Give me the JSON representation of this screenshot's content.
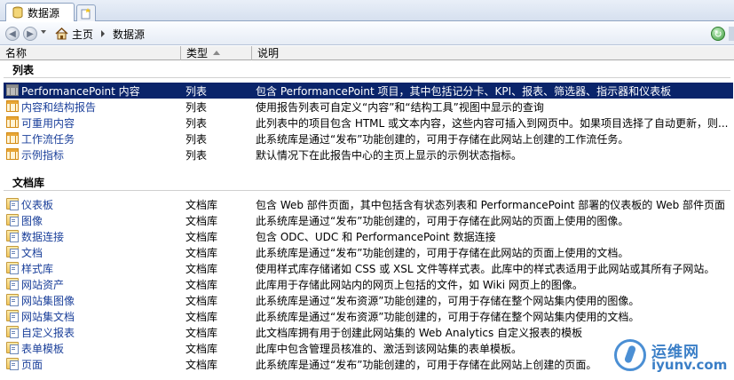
{
  "tabs": [
    {
      "label": "数据源",
      "icon": "database-icon"
    }
  ],
  "new_tab_icon": "new-tab-icon",
  "nav": {
    "back_icon": "back-arrow-icon",
    "forward_icon": "forward-arrow-icon",
    "breadcrumbs": [
      {
        "label": "主页",
        "icon": "home-icon"
      },
      {
        "label": "数据源"
      }
    ],
    "refresh_icon": "refresh-icon"
  },
  "columns": {
    "name": "名称",
    "type": "类型",
    "description": "说明"
  },
  "groups": [
    {
      "title": "列表",
      "rows": [
        {
          "name": "PerformancePoint 内容",
          "type": "列表",
          "desc": "包含 PerformancePoint 项目，其中包括记分卡、KPI、报表、筛选器、指示器和仪表板",
          "icon": "list-icon",
          "selected": true
        },
        {
          "name": "内容和结构报告",
          "type": "列表",
          "desc": "使用报告列表可自定义“内容”和“结构工具”视图中显示的查询",
          "icon": "list-icon"
        },
        {
          "name": "可重用内容",
          "type": "列表",
          "desc": "此列表中的项目包含 HTML 或文本内容，这些内容可插入到网页中。如果项目选择了自动更新，则...",
          "icon": "list-icon"
        },
        {
          "name": "工作流任务",
          "type": "列表",
          "desc": "此系统库是通过“发布”功能创建的，可用于存储在此网站上创建的工作流任务。",
          "icon": "list-icon"
        },
        {
          "name": "示例指标",
          "type": "列表",
          "desc": "默认情况下在此报告中心的主页上显示的示例状态指标。",
          "icon": "list-icon"
        }
      ]
    },
    {
      "title": "文档库",
      "rows": [
        {
          "name": "仪表板",
          "type": "文档库",
          "desc": "包含 Web 部件页面，其中包括含有状态列表和 PerformancePoint 部署的仪表板的 Web 部件页面",
          "icon": "document-library-icon"
        },
        {
          "name": "图像",
          "type": "文档库",
          "desc": "此系统库是通过“发布”功能创建的，可用于存储在此网站的页面上使用的图像。",
          "icon": "document-library-icon"
        },
        {
          "name": "数据连接",
          "type": "文档库",
          "desc": "包含 ODC、UDC 和 PerformancePoint 数据连接",
          "icon": "document-library-icon"
        },
        {
          "name": "文档",
          "type": "文档库",
          "desc": "此系统库是通过“发布”功能创建的，可用于存储在此网站的页面上使用的文档。",
          "icon": "document-library-icon"
        },
        {
          "name": "样式库",
          "type": "文档库",
          "desc": "使用样式库存储诸如 CSS 或 XSL 文件等样式表。此库中的样式表适用于此网站或其所有子网站。",
          "icon": "document-library-icon"
        },
        {
          "name": "网站资产",
          "type": "文档库",
          "desc": "此库用于存储此网站内的网页上包括的文件，如 Wiki 网页上的图像。",
          "icon": "document-library-icon"
        },
        {
          "name": "网站集图像",
          "type": "文档库",
          "desc": "此系统库是通过“发布资源”功能创建的，可用于存储在整个网站集内使用的图像。",
          "icon": "document-library-icon"
        },
        {
          "name": "网站集文档",
          "type": "文档库",
          "desc": "此系统库是通过“发布资源”功能创建的，可用于存储在整个网站集内使用的文档。",
          "icon": "document-library-icon"
        },
        {
          "name": "自定义报表",
          "type": "文档库",
          "desc": "此文档库拥有用于创建此网站集的 Web Analytics 自定义报表的模板",
          "icon": "document-library-icon"
        },
        {
          "name": "表单模板",
          "type": "文档库",
          "desc": "此库中包含管理员核准的、激活到该网站集的表单模板。",
          "icon": "document-library-icon"
        },
        {
          "name": "页面",
          "type": "文档库",
          "desc": "此系统库是通过“发布”功能创建的，可用于存储在此网站上创建的页面。",
          "icon": "document-library-icon"
        }
      ]
    }
  ],
  "watermark": {
    "text_cn": "运维网",
    "text_en": "iyunv.com",
    "icon": "watermark-logo-icon"
  },
  "colors": {
    "selected_row": "#0a246a",
    "link_text": "#1a3f9a",
    "header_bg": "#f1f1f1"
  }
}
